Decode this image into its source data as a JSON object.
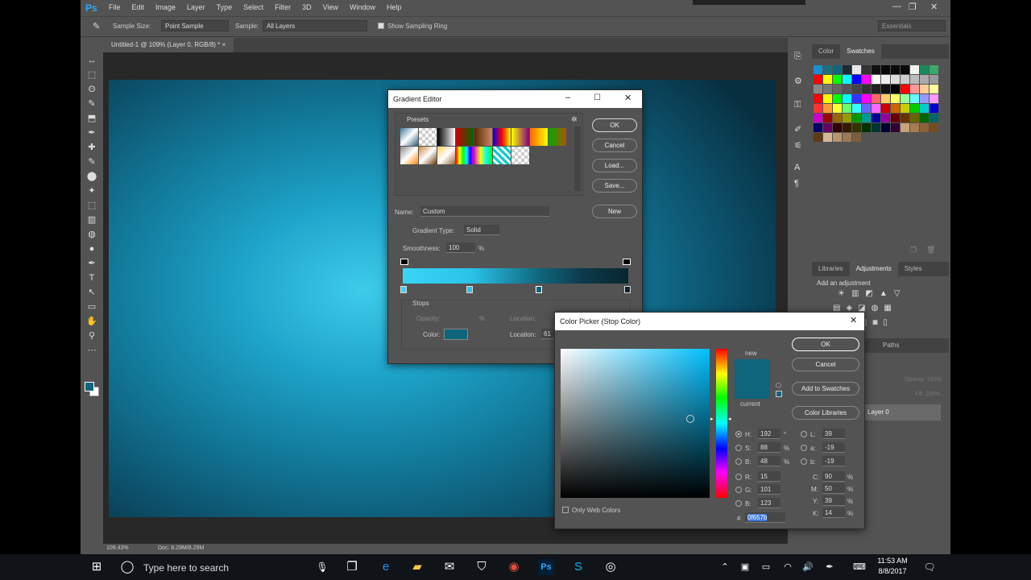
{
  "app": {
    "logo": "Ps",
    "menu": [
      "File",
      "Edit",
      "Image",
      "Layer",
      "Type",
      "Select",
      "Filter",
      "3D",
      "View",
      "Window",
      "Help"
    ],
    "window_controls": [
      "—",
      "❐",
      "✕"
    ]
  },
  "options_bar": {
    "sample_size_label": "Sample Size:",
    "sample_size_value": "Point Sample",
    "sample_label": "Sample:",
    "sample_value": "All Layers",
    "sampling_ring_label": "Show Sampling Ring",
    "workspace": "Essentials"
  },
  "document": {
    "tab_title": "Untitled-1 @ 109% (Layer 0, RGB/8) *",
    "zoom": "109.43%",
    "doc_info": "Doc: 8.29M/8.29M"
  },
  "tools": [
    "↔",
    "⬚",
    "ʘ",
    "✎",
    "⬒",
    "✒",
    "✚",
    "✎",
    "⬤",
    "✦",
    "⬚",
    "▥",
    "◍",
    "●",
    "✒",
    "T",
    "↖",
    "▭",
    "✋",
    "⚲",
    "⋯"
  ],
  "swatches_panel": {
    "tabs": [
      "Color",
      "Swatches"
    ],
    "active_tab": "Swatches",
    "colors": [
      "#1a8fd0",
      "#1c6f7f",
      "#0f657b",
      "#1c2a34",
      "#e8e8e8",
      "#333333",
      "#111111",
      "#0a0a0a",
      "#0a0a0a",
      "#0a0a0a",
      "#f2f2f2",
      "#1a8a5a",
      "#3aa86a",
      "#ff0000",
      "#ffff00",
      "#00ff00",
      "#00ffff",
      "#0000ff",
      "#ff00ff",
      "#ffffff",
      "#eeeeee",
      "#dddddd",
      "#cccccc",
      "#bbbbbb",
      "#aaaaaa",
      "#999999",
      "#888888",
      "#777777",
      "#666666",
      "#555555",
      "#444444",
      "#333333",
      "#222222",
      "#111111",
      "#000000",
      "#ff0000",
      "#ff9999",
      "#ffcc99",
      "#ffff99",
      "#ff0000",
      "#ffff00",
      "#00ff00",
      "#00ffff",
      "#3333ff",
      "#ff00ff",
      "#ff6666",
      "#ffcc66",
      "#ffff66",
      "#99ff99",
      "#66ffff",
      "#9999ff",
      "#ff99ff",
      "#ff3333",
      "#ff9933",
      "#ffff33",
      "#66ff66",
      "#33ffff",
      "#6666ff",
      "#ff66ff",
      "#cc0000",
      "#cc6600",
      "#cccc00",
      "#00cc00",
      "#00cccc",
      "#0000cc",
      "#cc00cc",
      "#990000",
      "#996600",
      "#999900",
      "#009900",
      "#009999",
      "#000099",
      "#990099",
      "#660000",
      "#663300",
      "#666600",
      "#006600",
      "#006666",
      "#000066",
      "#660066",
      "#330000",
      "#331a00",
      "#333300",
      "#003300",
      "#003333",
      "#000033",
      "#330033",
      "#c8a27a",
      "#a67c52",
      "#8c6239",
      "#754c24",
      "#603913",
      "#d4b896",
      "#b89470",
      "#9a7a56",
      "#7c5e3e"
    ],
    "tab_icons": [
      "new-swatch-icon",
      "delete-icon"
    ]
  },
  "adjustments_panel": {
    "tabs": [
      "Libraries",
      "Adjustments",
      "Styles"
    ],
    "active_tab": "Adjustments",
    "add_label": "Add an adjustment"
  },
  "layers_panel": {
    "tabs": [
      "Paths"
    ],
    "layer_name": "Layer 0",
    "opacity_label": "Opacity:",
    "opacity_value": "100%",
    "fill_label": "Fill:",
    "fill_value": "100%"
  },
  "gradient_editor": {
    "title": "Gradient Editor",
    "presets_label": "Presets",
    "ok": "OK",
    "cancel": "Cancel",
    "load": "Load...",
    "save": "Save...",
    "name_label": "Name:",
    "name_value": "Custom",
    "new": "New",
    "type_label": "Gradient Type:",
    "type_value": "Solid",
    "smoothness_label": "Smoothness:",
    "smoothness_value": "100",
    "percent": "%",
    "stops_label": "Stops",
    "opacity_label": "Opacity:",
    "location_label": "Location:",
    "color_label": "Color:",
    "location_value": "61",
    "stop_color": "#0f657b"
  },
  "color_picker": {
    "title": "Color Picker (Stop Color)",
    "ok": "OK",
    "cancel": "Cancel",
    "add_to_swatches": "Add to Swatches",
    "color_libraries": "Color Libraries",
    "new_label": "new",
    "current_label": "current",
    "only_web": "Only Web Colors",
    "hue_color": "#00bfff",
    "new_color": "#0f657b",
    "current_color": "#0f657b",
    "fields": {
      "H": "192",
      "S": "88",
      "B": "48",
      "R": "15",
      "G": "101",
      "B2": "123",
      "L": "39",
      "a": "-19",
      "b": "-19",
      "C": "90",
      "M": "50",
      "Y": "39",
      "K": "14",
      "hex": "0f657b"
    },
    "units": {
      "deg": "°",
      "pct": "%"
    }
  },
  "taskbar": {
    "search_placeholder": "Type here to search",
    "time": "11:53 AM",
    "date": "8/8/2017"
  }
}
